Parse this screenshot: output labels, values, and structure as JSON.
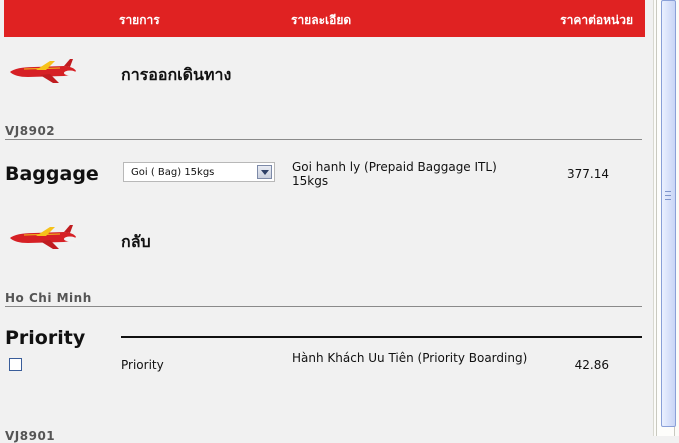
{
  "header": {
    "col_item": "รายการ",
    "col_detail": "รายละเอียด",
    "col_price": "ราคาต่อหน่วย"
  },
  "outbound": {
    "title": "การออกเดินทาง",
    "flight_code": "VJ8902"
  },
  "baggage": {
    "label": "Baggage",
    "selected": "Goi ( Bag) 15kgs",
    "description": "Goi hanh ly (Prepaid Baggage ITL) 15kgs",
    "price": "377.14"
  },
  "return": {
    "title": "กลับ",
    "city": "Ho Chi Minh"
  },
  "priority": {
    "label": "Priority",
    "item_name": "Priority",
    "description": "Hành Khách Uu Tiên (Priority Boarding)",
    "price": "42.86"
  },
  "next_code": "VJ8901",
  "colors": {
    "header_red": "#e02222",
    "background": "#f1f1f1",
    "plane_red": "#d62025",
    "plane_yellow": "#f6c21a"
  },
  "icons": [
    "airplane-icon",
    "chevron-down-icon",
    "checkbox-icon"
  ]
}
